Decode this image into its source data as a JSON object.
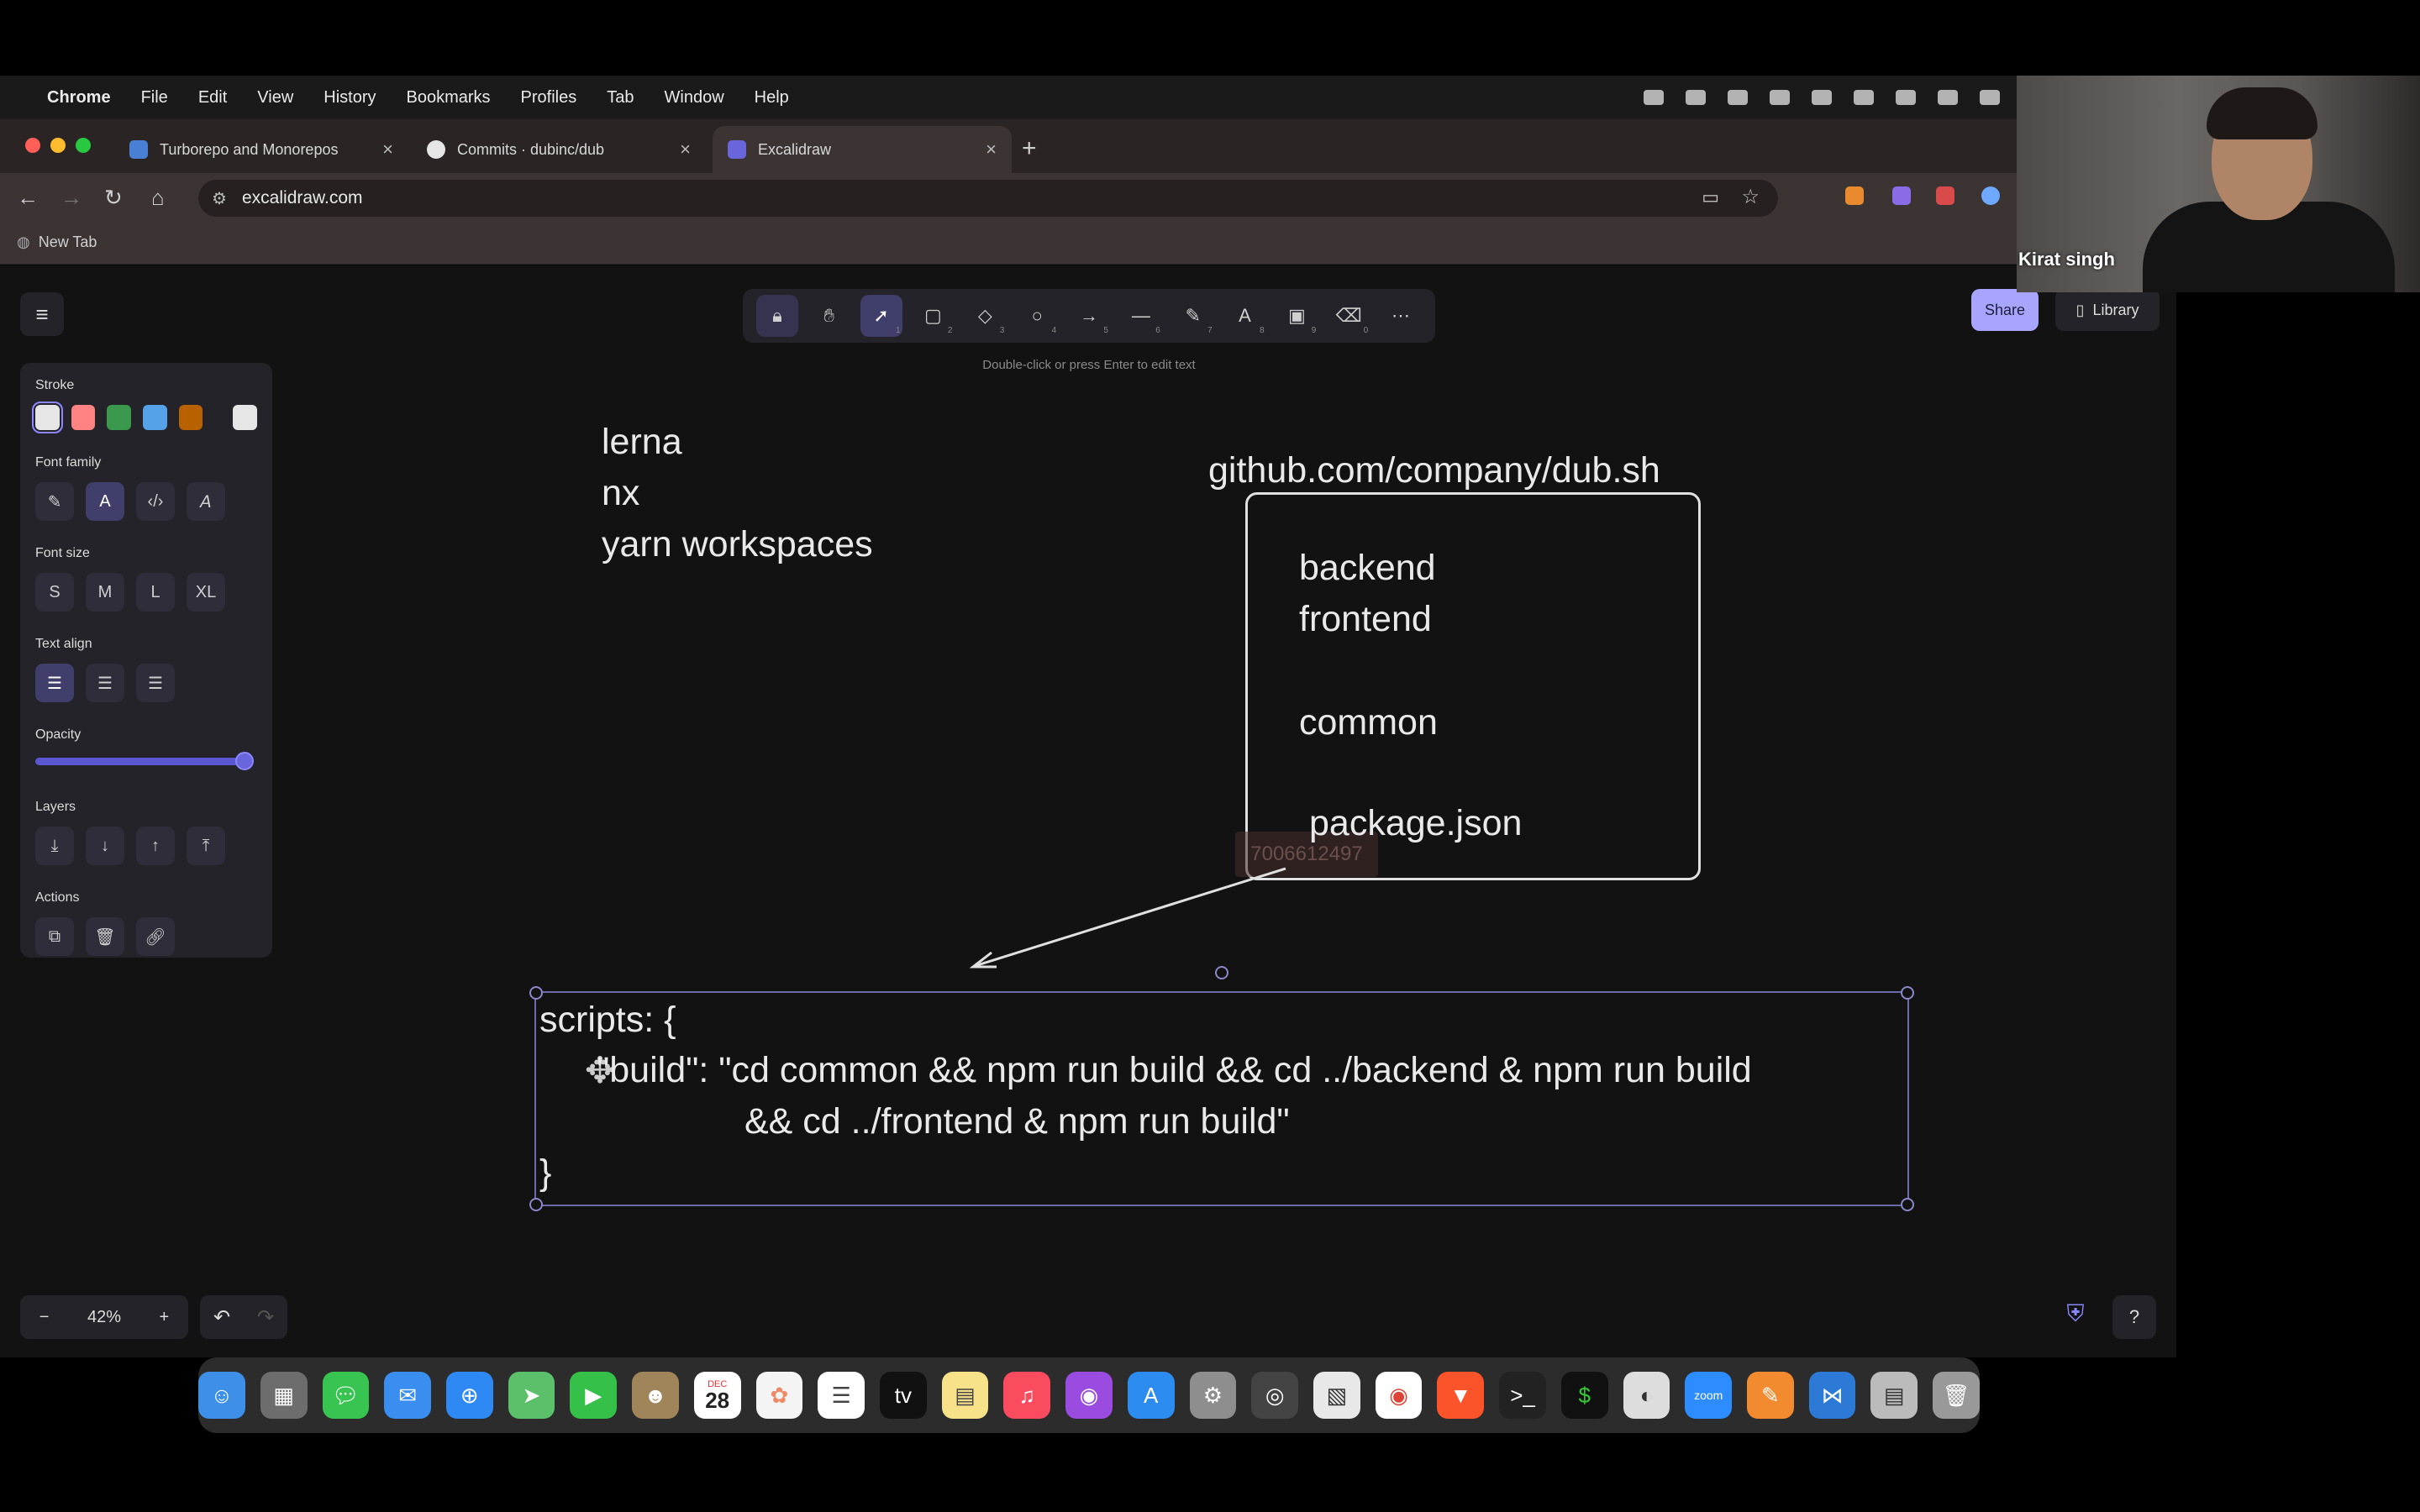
{
  "menubar": {
    "app": "Chrome",
    "items": [
      "File",
      "Edit",
      "View",
      "History",
      "Bookmarks",
      "Profiles",
      "Tab",
      "Window",
      "Help"
    ]
  },
  "tabs": [
    {
      "title": "Turborepo and Monorepos",
      "active": false,
      "favicon_color": "#4a7fd6"
    },
    {
      "title": "Commits · dubinc/dub",
      "active": false,
      "favicon_color": "#e6e6e6"
    },
    {
      "title": "Excalidraw",
      "active": true,
      "favicon_color": "#6965db"
    }
  ],
  "address_bar": {
    "url": "excalidraw.com"
  },
  "bookmarks": {
    "new_tab": "New Tab"
  },
  "excalidraw": {
    "hint": "Double-click or press Enter to edit text",
    "share_label": "Share",
    "library_label": "Library",
    "tool_keys": [
      "",
      "",
      "1",
      "2",
      "3",
      "4",
      "5",
      "6",
      "7",
      "8",
      "9",
      "0",
      ""
    ],
    "props": {
      "stroke_label": "Stroke",
      "stroke_colors": [
        "#e6e6e6",
        "#ff8383",
        "#3a994c",
        "#56a2e8",
        "#b76100",
        "#e6e6e6"
      ],
      "font_family_label": "Font family",
      "font_size_label": "Font size",
      "font_sizes": [
        "S",
        "M",
        "L",
        "XL"
      ],
      "text_align_label": "Text align",
      "opacity_label": "Opacity",
      "opacity_value": 1.0,
      "layers_label": "Layers",
      "actions_label": "Actions"
    },
    "zoom_level": "42%"
  },
  "canvas": {
    "tools_list": [
      "lerna",
      "nx",
      "yarn workspaces"
    ],
    "repo_url": "github.com/company/dub.sh",
    "repo_items": [
      "backend",
      "frontend",
      "common",
      "package.json"
    ],
    "cursor_tag": "7006612497",
    "code_lines": [
      "scripts: {",
      "\"build\": \"cd common && npm run build && cd ../backend & npm run build",
      "&& cd ../frontend & npm run build\"",
      "}"
    ]
  },
  "dock": {
    "calendar_month": "DEC",
    "calendar_day": "28"
  },
  "webcam": {
    "name": "Kirat singh"
  }
}
